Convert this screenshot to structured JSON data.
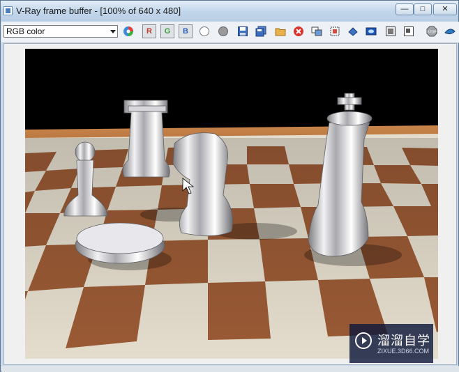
{
  "window": {
    "title": "V-Ray frame buffer - [100% of 640 x 480]"
  },
  "toolbar": {
    "channel_select": "RGB color",
    "channel_r": "R",
    "channel_g": "G",
    "channel_b": "B",
    "icons": [
      "color-wheel-icon",
      "red-channel-icon",
      "green-channel-icon",
      "blue-channel-icon",
      "white-sphere-icon",
      "gray-sphere-icon",
      "save-icon",
      "save-all-icon",
      "open-icon",
      "clear-icon",
      "duplicate-icon",
      "region-render-icon",
      "track-mouse-icon",
      "lens-effects-icon",
      "frame-stamp-icon",
      "compare-icon",
      "stop-icon",
      "render-icon"
    ]
  },
  "colors": {
    "title_bg": "#c3d7eb",
    "board_dark": "#9a5a35",
    "board_light": "#e4ddcd",
    "frame": "#b8773f"
  },
  "watermark": {
    "main": "溜溜自学",
    "sub": "ZIXUE.3D66.COM"
  }
}
